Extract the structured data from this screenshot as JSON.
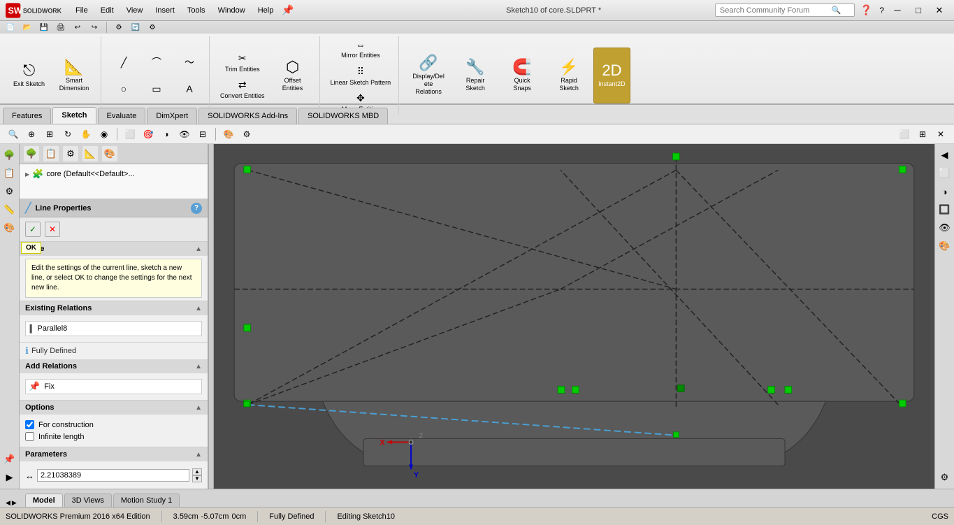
{
  "titlebar": {
    "file_label": "File",
    "edit_label": "Edit",
    "view_label": "View",
    "insert_label": "Insert",
    "tools_label": "Tools",
    "window_label": "Window",
    "help_label": "Help",
    "document_title": "Sketch10 of core.SLDPRT *",
    "search_placeholder": "Search Community Forum"
  },
  "toolbar": {
    "exit_sketch": "Exit Sketch",
    "smart_dimension": "Smart Dimension",
    "trim_entities": "Trim Entities",
    "convert_entities": "Convert Entities",
    "offset_entities": "Offset Entities",
    "mirror_entities": "Mirror Entities",
    "linear_sketch_pattern": "Linear Sketch Pattern",
    "move_entities": "Move Entities",
    "display_delete_relations": "Display/Delete Relations",
    "repair_sketch": "Repair Sketch",
    "quick_snaps": "Quick Snaps",
    "rapid_sketch": "Rapid Sketch",
    "instant2d": "Instant2D"
  },
  "tabs": {
    "features": "Features",
    "sketch": "Sketch",
    "evaluate": "Evaluate",
    "dimxpert": "DimXpert",
    "solidworks_addins": "SOLIDWORKS Add-Ins",
    "solidworks_mbd": "SOLIDWORKS MBD"
  },
  "feature_tree": {
    "core_label": "core  (Default<<Default>..."
  },
  "property_panel": {
    "title": "Line Properties",
    "help_icon": "?",
    "ok_label": "OK",
    "cancel_label": "✕",
    "make_section_label": "Make",
    "tooltip_text": "Edit the settings of the current line, sketch a new line, or select OK to change the settings for the next new line.",
    "existing_relations_label": "Existing Relations",
    "relation_item": "Parallel8",
    "fully_defined_label": "Fully Defined",
    "add_relations_label": "Add Relations",
    "fix_label": "Fix",
    "options_label": "Options",
    "for_construction_label": "For construction",
    "infinite_length_label": "Infinite length",
    "parameters_label": "Parameters",
    "param_value": "2.21038389"
  },
  "bottom_tabs": {
    "model": "Model",
    "three_d_views": "3D Views",
    "motion_study": "Motion Study 1"
  },
  "status_bar": {
    "brand": "SOLIDWORKS Premium 2016 x64 Edition",
    "coords_x": "3.59cm",
    "coords_y": "-5.07cm",
    "coords_z": "0cm",
    "status": "Fully Defined",
    "editing": "Editing Sketch10",
    "unit": "CGS"
  },
  "ok_tooltip": "OK"
}
